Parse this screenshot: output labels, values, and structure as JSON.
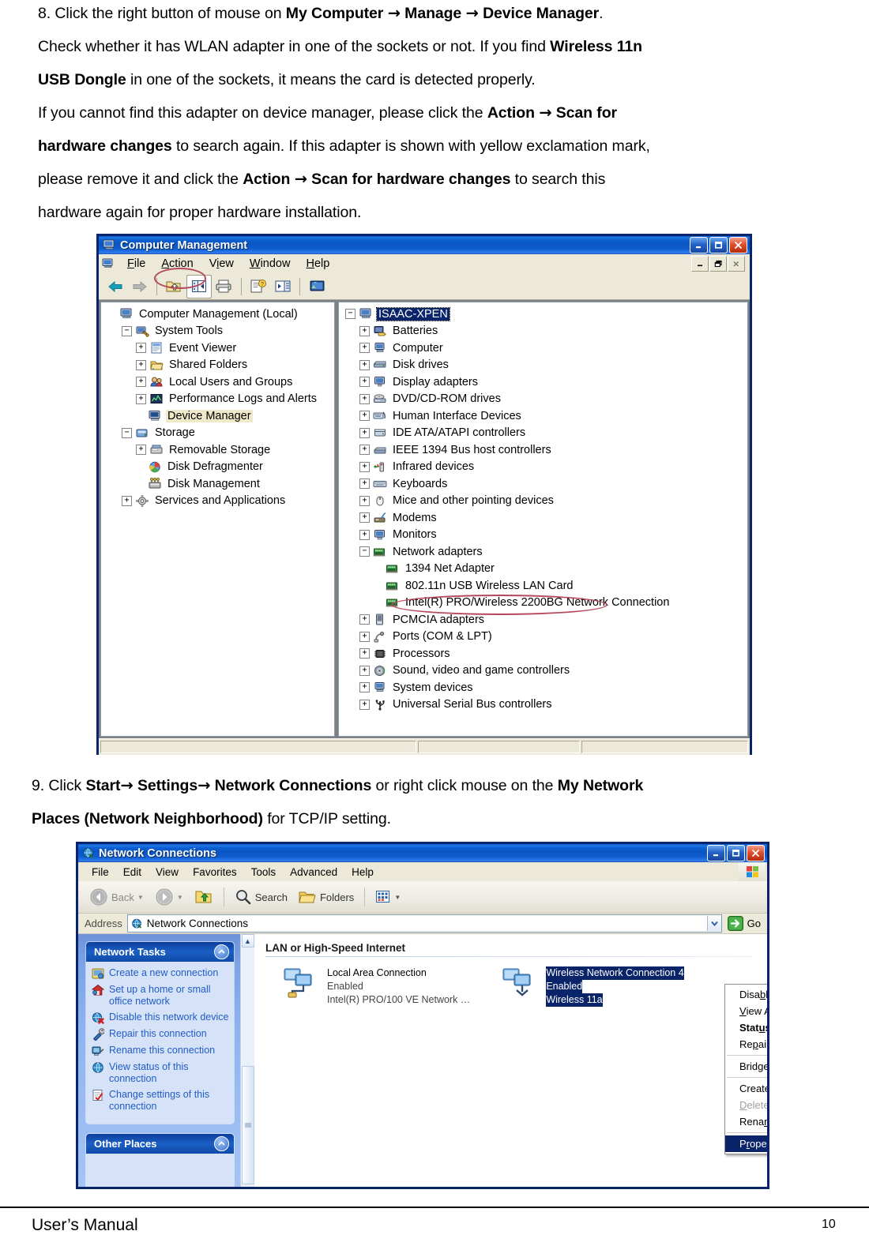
{
  "document": {
    "step8": {
      "lines": [
        [
          {
            "t": "8. Click the right button of mouse on ",
            "b": false
          },
          {
            "t": "My Computer ",
            "b": true
          },
          {
            "t": "→",
            "b": true,
            "arrow": true
          },
          {
            "t": " Manage ",
            "b": true
          },
          {
            "t": "→",
            "b": true,
            "arrow": true
          },
          {
            "t": " Device Manager",
            "b": true
          },
          {
            "t": ".",
            "b": false
          }
        ],
        [
          {
            "t": "Check whether it has WLAN adapter in one of the sockets or not.  If you find ",
            "b": false
          },
          {
            "t": "Wireless 11n",
            "b": true
          }
        ],
        [
          {
            "t": "USB Dongle",
            "b": true
          },
          {
            "t": " in one of the sockets, it means the card is detected properly.",
            "b": false
          }
        ],
        [
          {
            "t": "If you cannot find this adapter on device manager, please click the ",
            "b": false
          },
          {
            "t": "Action ",
            "b": true
          },
          {
            "t": "→",
            "b": true,
            "arrow": true
          },
          {
            "t": " Scan for",
            "b": true
          }
        ],
        [
          {
            "t": "hardware changes",
            "b": true
          },
          {
            "t": " to search again. If this adapter is shown with yellow exclamation mark,",
            "b": false
          }
        ],
        [
          {
            "t": "please remove it and click the ",
            "b": false
          },
          {
            "t": "Action ",
            "b": true
          },
          {
            "t": "→",
            "b": true,
            "arrow": true
          },
          {
            "t": " Scan for hardware changes",
            "b": true
          },
          {
            "t": " to search this",
            "b": false
          }
        ],
        [
          {
            "t": "hardware again for proper hardware installation.",
            "b": false
          }
        ]
      ]
    },
    "step9": {
      "lines": [
        [
          {
            "t": "9. Click ",
            "b": false
          },
          {
            "t": "Start",
            "b": true
          },
          {
            "t": "→",
            "b": true,
            "arrow": true
          },
          {
            "t": " Settings",
            "b": true
          },
          {
            "t": "→",
            "b": true,
            "arrow": true
          },
          {
            "t": " Network Connections",
            "b": true
          },
          {
            "t": " or right click mouse on the ",
            "b": false
          },
          {
            "t": "My Network",
            "b": true
          }
        ],
        [
          {
            "t": "Places (Network Neighborhood)",
            "b": true
          },
          {
            "t": " for TCP/IP setting.",
            "b": false
          }
        ]
      ]
    },
    "footer": {
      "label": "User’s Manual",
      "page_number": "10"
    }
  },
  "computer_management": {
    "title": "Computer Management",
    "window_buttons": {
      "minimize": "minimize-icon",
      "maximize": "maximize-icon",
      "close": "close-icon"
    },
    "mdi_buttons": {
      "minimize": "mdi-minimize-icon",
      "restore": "mdi-restore-icon",
      "close": "mdi-close-icon"
    },
    "menu": [
      {
        "label": "File",
        "accel": "F"
      },
      {
        "label": "Action",
        "accel": "A",
        "annotated": true
      },
      {
        "label": "View",
        "accel": "V"
      },
      {
        "label": "Window",
        "accel": "W"
      },
      {
        "label": "Help",
        "accel": "H"
      }
    ],
    "toolbar": [
      {
        "name": "back-icon"
      },
      {
        "name": "forward-icon"
      },
      {
        "name": "up-one-level-icon"
      },
      {
        "name": "show-hide-console-tree-icon",
        "pressed": true
      },
      {
        "name": "print-icon"
      },
      {
        "name": "properties-icon"
      },
      {
        "name": "export-list-icon"
      },
      {
        "name": "help-topics-icon"
      }
    ],
    "console_tree": [
      {
        "label": "Computer Management (Local)",
        "depth": 0,
        "expander": "none",
        "icon": "computer-icon"
      },
      {
        "label": "System Tools",
        "depth": 1,
        "expander": "minus",
        "icon": "system-tools-icon"
      },
      {
        "label": "Event Viewer",
        "depth": 2,
        "expander": "plus",
        "icon": "event-viewer-icon"
      },
      {
        "label": "Shared Folders",
        "depth": 2,
        "expander": "plus",
        "icon": "shared-folders-icon"
      },
      {
        "label": "Local Users and Groups",
        "depth": 2,
        "expander": "plus",
        "icon": "users-groups-icon"
      },
      {
        "label": "Performance Logs and Alerts",
        "depth": 2,
        "expander": "plus",
        "icon": "performance-icon"
      },
      {
        "label": "Device Manager",
        "depth": 2,
        "expander": "none",
        "icon": "device-manager-icon",
        "highlighted": true
      },
      {
        "label": "Storage",
        "depth": 1,
        "expander": "minus",
        "icon": "storage-icon"
      },
      {
        "label": "Removable Storage",
        "depth": 2,
        "expander": "plus",
        "icon": "removable-storage-icon"
      },
      {
        "label": "Disk Defragmenter",
        "depth": 2,
        "expander": "none",
        "icon": "defragmenter-icon"
      },
      {
        "label": "Disk Management",
        "depth": 2,
        "expander": "none",
        "icon": "disk-management-icon"
      },
      {
        "label": "Services and Applications",
        "depth": 1,
        "expander": "plus",
        "icon": "services-icon"
      }
    ],
    "device_tree": [
      {
        "label": "ISAAC-XPEN",
        "depth": 0,
        "expander": "minus",
        "icon": "computer-icon",
        "selected": true
      },
      {
        "label": "Batteries",
        "depth": 1,
        "expander": "plus",
        "icon": "battery-icon"
      },
      {
        "label": "Computer",
        "depth": 1,
        "expander": "plus",
        "icon": "computer-node-icon"
      },
      {
        "label": "Disk drives",
        "depth": 1,
        "expander": "plus",
        "icon": "disk-drive-icon"
      },
      {
        "label": "Display adapters",
        "depth": 1,
        "expander": "plus",
        "icon": "display-adapter-icon"
      },
      {
        "label": "DVD/CD-ROM drives",
        "depth": 1,
        "expander": "plus",
        "icon": "dvd-drive-icon"
      },
      {
        "label": "Human Interface Devices",
        "depth": 1,
        "expander": "plus",
        "icon": "hid-icon"
      },
      {
        "label": "IDE ATA/ATAPI controllers",
        "depth": 1,
        "expander": "plus",
        "icon": "ide-controller-icon"
      },
      {
        "label": "IEEE 1394 Bus host controllers",
        "depth": 1,
        "expander": "plus",
        "icon": "ieee1394-icon"
      },
      {
        "label": "Infrared devices",
        "depth": 1,
        "expander": "plus",
        "icon": "infrared-icon"
      },
      {
        "label": "Keyboards",
        "depth": 1,
        "expander": "plus",
        "icon": "keyboard-icon"
      },
      {
        "label": "Mice and other pointing devices",
        "depth": 1,
        "expander": "plus",
        "icon": "mouse-icon"
      },
      {
        "label": "Modems",
        "depth": 1,
        "expander": "plus",
        "icon": "modem-icon"
      },
      {
        "label": "Monitors",
        "depth": 1,
        "expander": "plus",
        "icon": "monitor-icon"
      },
      {
        "label": "Network adapters",
        "depth": 1,
        "expander": "minus",
        "icon": "network-adapter-icon"
      },
      {
        "label": "1394 Net Adapter",
        "depth": 2,
        "expander": "none",
        "icon": "network-adapter-icon"
      },
      {
        "label": "802.11n USB Wireless LAN Card",
        "depth": 2,
        "expander": "none",
        "icon": "network-adapter-icon",
        "annotated": true
      },
      {
        "label": "Intel(R) PRO/Wireless 2200BG Network Connection",
        "depth": 2,
        "expander": "none",
        "icon": "network-adapter-icon"
      },
      {
        "label": "PCMCIA adapters",
        "depth": 1,
        "expander": "plus",
        "icon": "pcmcia-icon"
      },
      {
        "label": "Ports (COM & LPT)",
        "depth": 1,
        "expander": "plus",
        "icon": "ports-icon"
      },
      {
        "label": "Processors",
        "depth": 1,
        "expander": "plus",
        "icon": "processor-icon"
      },
      {
        "label": "Sound, video and game controllers",
        "depth": 1,
        "expander": "plus",
        "icon": "sound-icon"
      },
      {
        "label": "System devices",
        "depth": 1,
        "expander": "plus",
        "icon": "system-device-icon"
      },
      {
        "label": "Universal Serial Bus controllers",
        "depth": 1,
        "expander": "plus",
        "icon": "usb-controller-icon"
      }
    ],
    "status_bar": [
      "",
      "",
      ""
    ]
  },
  "network_connections": {
    "title": "Network Connections",
    "menu": [
      "File",
      "Edit",
      "View",
      "Favorites",
      "Tools",
      "Advanced",
      "Help"
    ],
    "toolbar": {
      "back": "Back",
      "forward": "",
      "up": "",
      "search": "Search",
      "folders": "Folders",
      "views": ""
    },
    "address": {
      "label": "Address",
      "value": "Network Connections",
      "go_label": "Go"
    },
    "tasks_panel": {
      "title": "Network Tasks",
      "items": [
        {
          "label": "Create a new connection",
          "icon": "new-connection-icon"
        },
        {
          "label": "Set up a home or small office network",
          "icon": "home-network-icon"
        },
        {
          "label": "Disable this network device",
          "icon": "disable-device-icon"
        },
        {
          "label": "Repair this connection",
          "icon": "repair-icon"
        },
        {
          "label": "Rename this connection",
          "icon": "rename-icon"
        },
        {
          "label": "View status of this connection",
          "icon": "view-status-icon"
        },
        {
          "label": "Change settings of this connection",
          "icon": "change-settings-icon"
        }
      ]
    },
    "other_places_panel": {
      "title": "Other Places"
    },
    "group_title": "LAN or High-Speed Internet",
    "connections": [
      {
        "name": "Local Area Connection",
        "status": "Enabled",
        "device": "Intel(R) PRO/100 VE Network …",
        "selected": false,
        "icon": "lan-connection-icon"
      },
      {
        "name": "Wireless Network Connection 4",
        "status": "Enabled",
        "device": "Wireless 11a",
        "selected": true,
        "icon": "wireless-connection-icon"
      }
    ],
    "context_menu": [
      {
        "label": "Disable",
        "accel": "b",
        "type": "item"
      },
      {
        "label": "View Available Wireless Networks",
        "accel": "V",
        "type": "item"
      },
      {
        "label": "Status",
        "accel": "u",
        "type": "item",
        "bold": true
      },
      {
        "label": "Repair",
        "accel": "p",
        "type": "item"
      },
      {
        "type": "divider"
      },
      {
        "label": "Bridge Connections",
        "accel": "g",
        "type": "item"
      },
      {
        "type": "divider"
      },
      {
        "label": "Create Shortcut",
        "accel": "S",
        "type": "item"
      },
      {
        "label": "Delete",
        "accel": "D",
        "type": "item",
        "disabled": true
      },
      {
        "label": "Rename",
        "accel": "m",
        "type": "item"
      },
      {
        "type": "divider"
      },
      {
        "label": "Properties",
        "accel": "r",
        "type": "item",
        "highlighted": true
      }
    ]
  },
  "colors": {
    "xp_title_blue": "#0a5ad4",
    "xp_border": "#0a246a",
    "xp_face": "#ece9d8",
    "selection_blue": "#0a246a",
    "annotation_red": "#b5485c",
    "task_link": "#215dc6"
  }
}
